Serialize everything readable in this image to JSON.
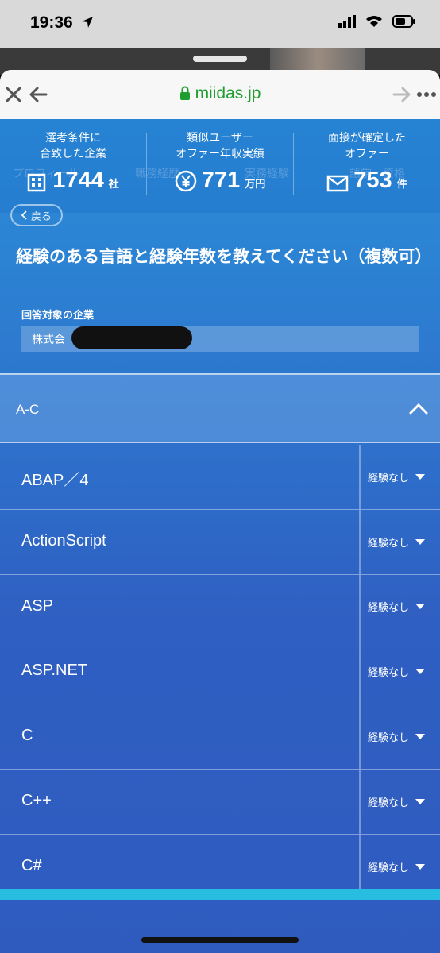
{
  "status": {
    "time": "19:36"
  },
  "browser": {
    "domain": "miidas.jp"
  },
  "stats": [
    {
      "label": "選考条件に\n合致した企業",
      "value": "1744",
      "unit": "社",
      "icon": "building-icon"
    },
    {
      "label": "類似ユーザー\nオファー年収実績",
      "value": "771",
      "unit": "万円",
      "icon": "yen-icon"
    },
    {
      "label": "面接が確定した\nオファー",
      "value": "753",
      "unit": "件",
      "icon": "mail-icon"
    }
  ],
  "steps": [
    "プロフィール",
    "職務経歴",
    "実務経験",
    "語学・資格"
  ],
  "back_label": "戻る",
  "question": "経験のある言語と経験年数を教えてください（複数可）",
  "company": {
    "label": "回答対象の企業",
    "value": "株式会"
  },
  "section": {
    "title": "A-C"
  },
  "languages": [
    {
      "name": "ABAP／4",
      "experience": "経験なし"
    },
    {
      "name": "ActionScript",
      "experience": "経験なし"
    },
    {
      "name": "ASP",
      "experience": "経験なし"
    },
    {
      "name": "ASP.NET",
      "experience": "経験なし"
    },
    {
      "name": "C",
      "experience": "経験なし"
    },
    {
      "name": "C++",
      "experience": "経験なし"
    },
    {
      "name": "C#",
      "experience": "経験なし"
    }
  ],
  "colors": {
    "url_green": "#1f9d2e",
    "accent_blue": "#2f6fca",
    "footer_cyan": "#27bde0"
  }
}
